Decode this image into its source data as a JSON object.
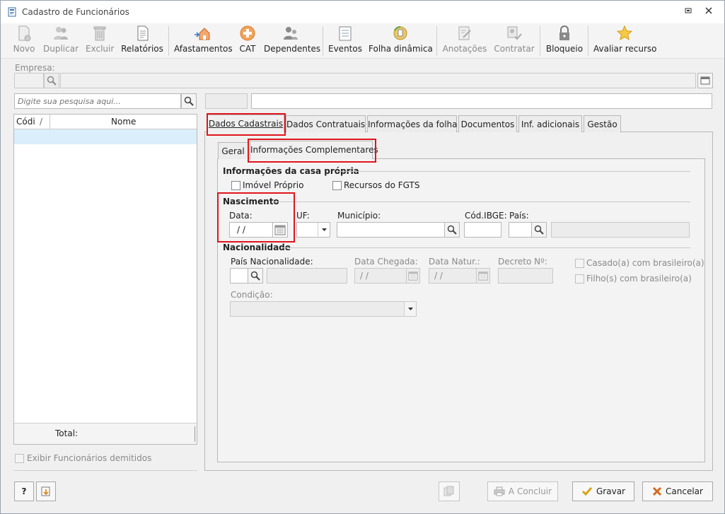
{
  "window": {
    "title": "Cadastro de Funcionários"
  },
  "toolbar": {
    "novo": "Novo",
    "duplicar": "Duplicar",
    "excluir": "Excluir",
    "relatorios": "Relatórios",
    "afastamentos": "Afastamentos",
    "cat": "CAT",
    "dependentes": "Dependentes",
    "eventos": "Eventos",
    "folha_dinamica": "Folha dinâmica",
    "anotacoes": "Anotações",
    "contratar": "Contratar",
    "bloqueio": "Bloqueio",
    "avaliar_recurso": "Avaliar recurso"
  },
  "empresa": {
    "label": "Empresa:"
  },
  "search": {
    "placeholder": "Digite sua pesquisa aqui..."
  },
  "list": {
    "col_codigo": "Códi",
    "col_sort": "/",
    "col_nome": "Nome",
    "total_label": "Total:"
  },
  "exibir_demitidos": "Exibir Funcionários demitidos",
  "tabs": {
    "dados_cadastrais": "Dados Cadastrais",
    "dados_contratuais": "Dados Contratuais",
    "informacoes_folha": "Informações da folha",
    "documentos": "Documentos",
    "inf_adicionais": "Inf. adicionais",
    "gestao": "Gestão"
  },
  "subtabs": {
    "geral": "Geral",
    "informacoes_complementares": "Informações Complementares"
  },
  "casa_propria": {
    "title": "Informações da casa própria",
    "imovel_proprio": "Imóvel Próprio",
    "recursos_fgts": "Recursos do FGTS"
  },
  "nascimento": {
    "title": "Nascimento",
    "data_label": "Data:",
    "data_value": " /  /",
    "uf_label": "UF:",
    "municipio_label": "Município:",
    "cod_ibge_label": "Cód.IBGE:",
    "pais_label": "País:"
  },
  "nacionalidade": {
    "title": "Nacionalidade",
    "pais_label": "País Nacionalidade:",
    "data_chegada_label": "Data Chegada:",
    "data_chegada_value": "/  /",
    "data_natur_label": "Data Natur.:",
    "data_natur_value": "/  /",
    "decreto_label": "Decreto Nº:",
    "casado_label": "Casado(a) com brasileiro(a)",
    "filhos_label": "Filho(s) com brasileiro(a)",
    "condicao_label": "Condição:"
  },
  "footer": {
    "concluir": "A Concluir",
    "gravar": "Gravar",
    "cancelar": "Cancelar",
    "help": "?"
  },
  "colors": {
    "highlight_red": "#e0151c",
    "selected_row": "#dbeefb"
  }
}
